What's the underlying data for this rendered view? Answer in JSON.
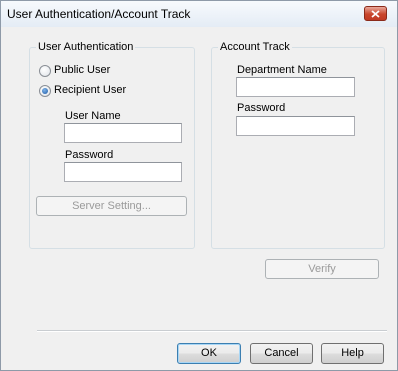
{
  "window": {
    "title": "User Authentication/Account Track"
  },
  "user_auth": {
    "legend": "User Authentication",
    "options": [
      {
        "label": "Public User",
        "selected": false
      },
      {
        "label": "Recipient User",
        "selected": true
      }
    ],
    "username_label": "User Name",
    "username_value": "",
    "password_label": "Password",
    "password_value": "",
    "server_setting_label": "Server Setting..."
  },
  "account_track": {
    "legend": "Account Track",
    "department_label": "Department Name",
    "department_value": "",
    "password_label": "Password",
    "password_value": ""
  },
  "verify_label": "Verify",
  "footer": {
    "ok_label": "OK",
    "cancel_label": "Cancel",
    "help_label": "Help"
  },
  "icons": {
    "close": "close-icon"
  },
  "colors": {
    "close_button": "#c9462c",
    "dialog_bg": "#f0f0f0"
  }
}
